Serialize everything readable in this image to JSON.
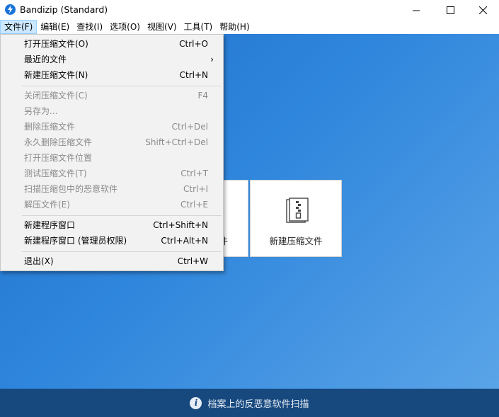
{
  "window": {
    "title": "Bandizip (Standard)",
    "minimize_glyph": "—",
    "maximize_glyph": "☐",
    "close_glyph": "✕"
  },
  "menubar": [
    {
      "label": "文件(F)",
      "active": true
    },
    {
      "label": "编辑(E)"
    },
    {
      "label": "查找(I)"
    },
    {
      "label": "选项(O)"
    },
    {
      "label": "视图(V)"
    },
    {
      "label": "工具(T)"
    },
    {
      "label": "帮助(H)"
    }
  ],
  "file_menu": {
    "items": [
      {
        "label": "打开压缩文件(O)",
        "shortcut": "Ctrl+O",
        "enabled": true
      },
      {
        "label": "最近的文件",
        "shortcut": "",
        "enabled": true,
        "submenu_arrow": "›"
      },
      {
        "label": "新建压缩文件(N)",
        "shortcut": "Ctrl+N",
        "enabled": true
      },
      {
        "label": "关闭压缩文件(C)",
        "shortcut": "F4",
        "enabled": false
      },
      {
        "label": "另存为...",
        "shortcut": "",
        "enabled": false
      },
      {
        "label": "删除压缩文件",
        "shortcut": "Ctrl+Del",
        "enabled": false
      },
      {
        "label": "永久删除压缩文件",
        "shortcut": "Shift+Ctrl+Del",
        "enabled": false
      },
      {
        "label": "打开压缩文件位置",
        "shortcut": "",
        "enabled": false
      },
      {
        "label": "测试压缩文件(T)",
        "shortcut": "Ctrl+T",
        "enabled": false
      },
      {
        "label": "扫描压缩包中的恶意软件",
        "shortcut": "Ctrl+I",
        "enabled": false
      },
      {
        "label": "解压文件(E)",
        "shortcut": "Ctrl+E",
        "enabled": false
      },
      {
        "label": "新建程序窗口",
        "shortcut": "Ctrl+Shift+N",
        "enabled": true
      },
      {
        "label": "新建程序窗口 (管理员权限)",
        "shortcut": "Ctrl+Alt+N",
        "enabled": true
      },
      {
        "label": "退出(X)",
        "shortcut": "Ctrl+W",
        "enabled": true
      }
    ]
  },
  "cards": [
    {
      "label": "件"
    },
    {
      "label": "新建压缩文件",
      "icon": "zip-archive-icon"
    }
  ],
  "bottom_bar": {
    "icon": "info-icon",
    "icon_glyph": "i",
    "text": "档案上的反恶意软件扫描"
  },
  "colors": {
    "background_gradient_start": "#1f6fc9",
    "background_gradient_end": "#5aa4e8",
    "bottom_bar": "#17497f",
    "menu_active": "#cce8ff",
    "disabled_text": "#8a8a8a"
  }
}
